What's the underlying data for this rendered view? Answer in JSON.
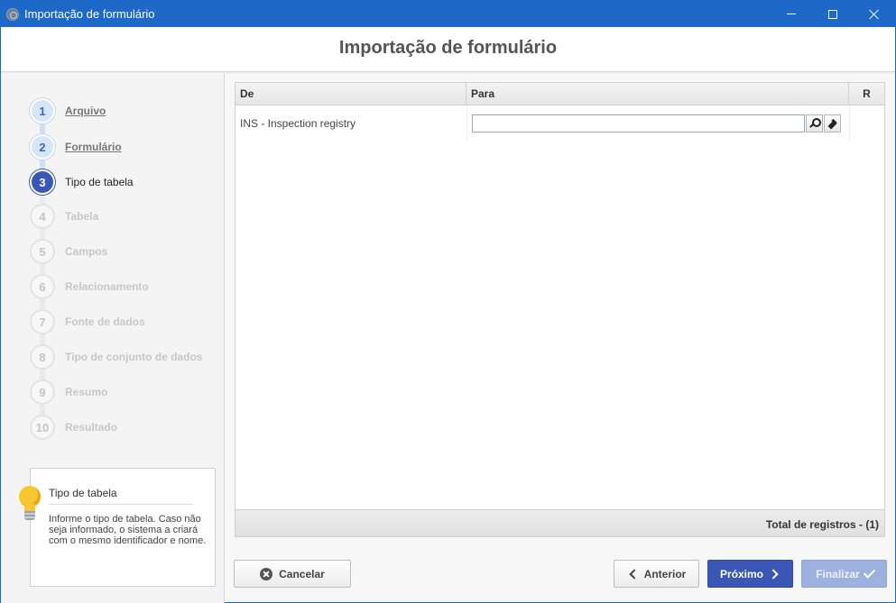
{
  "window": {
    "title": "Importação de formulário"
  },
  "header": {
    "title": "Importação de formulário"
  },
  "steps": [
    {
      "number": "1",
      "label": "Arquivo",
      "state": "done"
    },
    {
      "number": "2",
      "label": "Formulário",
      "state": "done"
    },
    {
      "number": "3",
      "label": "Tipo de tabela",
      "state": "current"
    },
    {
      "number": "4",
      "label": "Tabela",
      "state": "todo"
    },
    {
      "number": "5",
      "label": "Campos",
      "state": "todo"
    },
    {
      "number": "6",
      "label": "Relacionamento",
      "state": "todo"
    },
    {
      "number": "7",
      "label": "Fonte de dados",
      "state": "todo"
    },
    {
      "number": "8",
      "label": "Tipo de conjunto de dados",
      "state": "todo"
    },
    {
      "number": "9",
      "label": "Resumo",
      "state": "todo"
    },
    {
      "number": "10",
      "label": "Resultado",
      "state": "todo"
    }
  ],
  "tip": {
    "icon": "lightbulb-icon",
    "title": "Tipo de tabela",
    "text": "Informe o tipo de tabela. Caso não seja informado, o sistema a criará com o mesmo identificador e nome."
  },
  "grid": {
    "columns": [
      "De",
      "Para",
      "R"
    ],
    "rows": [
      {
        "de": "INS - Inspection registry",
        "para": ""
      }
    ],
    "total": "Total de registros  - (1)"
  },
  "buttons": {
    "cancel": "Cancelar",
    "previous": "Anterior",
    "next": "Próximo",
    "finish": "Finalizar"
  },
  "colors": {
    "titlebar": "#1e68c8",
    "primary": "#3a57b5",
    "disabled_primary": "#9db0de"
  }
}
